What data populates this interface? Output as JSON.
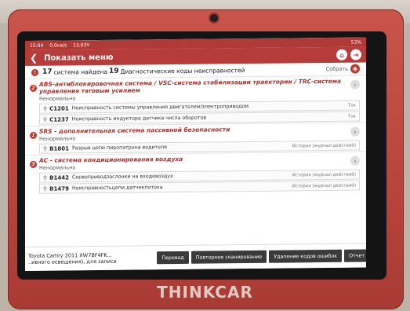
{
  "statusbar": {
    "time": "15:04",
    "net": "0,0кв/s",
    "voltage": "13,83V",
    "battery": "53%"
  },
  "header": {
    "title": "Показать меню"
  },
  "summary": {
    "systems_count": "17",
    "systems_text": "система найдена",
    "codes_count": "19",
    "codes_text": "Диагностические коды неисправностей",
    "collapse": "Собрать"
  },
  "systems": [
    {
      "index": "2",
      "title": "ABS-антиблокировочная система / VSC-система стабилизации траектории / TRC-система управления тяговым усилием",
      "status": "Ненормально",
      "codes": [
        {
          "code": "C1201",
          "desc": "Неисправность системы управления двигателем/электроприводом",
          "tag": "Ток"
        },
        {
          "code": "C1237",
          "desc": "Неисправность индуктора датчика числа оборотов",
          "tag": "Ток"
        }
      ]
    },
    {
      "index": "1",
      "title": "SRS - дополнительная система пассивной безопасности",
      "status": "Ненормально",
      "codes": [
        {
          "code": "B1801",
          "desc": "Разрыв цепи пиропатрона водителя",
          "tag": "История (журнал действий)"
        }
      ]
    },
    {
      "index": "3",
      "title": "AC - система кондиционирования воздуха",
      "status": "Ненормально",
      "codes": [
        {
          "code": "B1442",
          "desc": "Сервоприводзаслонки на входевоздух",
          "tag": "История (журнал действий)"
        },
        {
          "code": "B1479",
          "desc": "Неисправностьцепи датчикпотока",
          "tag": "История (журнал действий)"
        }
      ]
    }
  ],
  "bottom": {
    "vehicle_line1": "Toyota  Camry 2011  XW7BF4FK...",
    "vehicle_line2": "..ивного освещения), для записи",
    "buttons": [
      "Перевод",
      "Повторное сканирование",
      "Удаление кодов ошибок",
      "Отчет"
    ]
  },
  "brand": "THINKCAR",
  "colors": {
    "accent": "#b53c3b",
    "error_text": "#b0302c"
  }
}
